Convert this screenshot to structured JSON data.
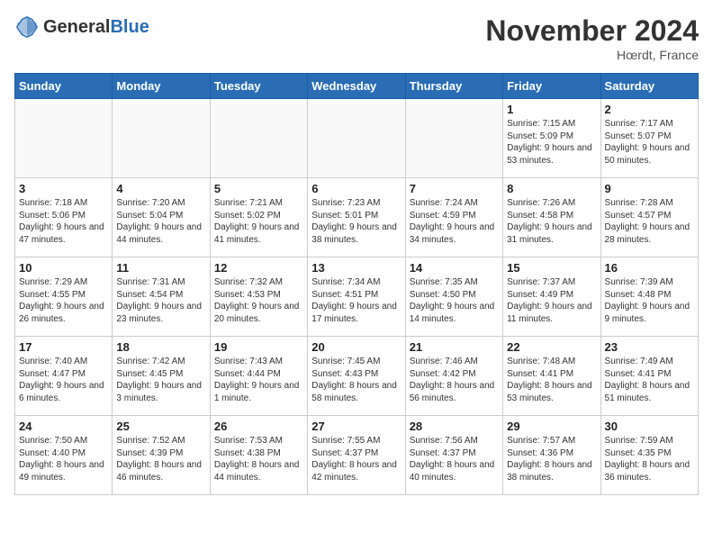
{
  "header": {
    "logo_general": "General",
    "logo_blue": "Blue",
    "month_title": "November 2024",
    "location": "Hœrdt, France"
  },
  "days_of_week": [
    "Sunday",
    "Monday",
    "Tuesday",
    "Wednesday",
    "Thursday",
    "Friday",
    "Saturday"
  ],
  "weeks": [
    [
      {
        "day": "",
        "info": ""
      },
      {
        "day": "",
        "info": ""
      },
      {
        "day": "",
        "info": ""
      },
      {
        "day": "",
        "info": ""
      },
      {
        "day": "",
        "info": ""
      },
      {
        "day": "1",
        "info": "Sunrise: 7:15 AM\nSunset: 5:09 PM\nDaylight: 9 hours and 53 minutes."
      },
      {
        "day": "2",
        "info": "Sunrise: 7:17 AM\nSunset: 5:07 PM\nDaylight: 9 hours and 50 minutes."
      }
    ],
    [
      {
        "day": "3",
        "info": "Sunrise: 7:18 AM\nSunset: 5:06 PM\nDaylight: 9 hours and 47 minutes."
      },
      {
        "day": "4",
        "info": "Sunrise: 7:20 AM\nSunset: 5:04 PM\nDaylight: 9 hours and 44 minutes."
      },
      {
        "day": "5",
        "info": "Sunrise: 7:21 AM\nSunset: 5:02 PM\nDaylight: 9 hours and 41 minutes."
      },
      {
        "day": "6",
        "info": "Sunrise: 7:23 AM\nSunset: 5:01 PM\nDaylight: 9 hours and 38 minutes."
      },
      {
        "day": "7",
        "info": "Sunrise: 7:24 AM\nSunset: 4:59 PM\nDaylight: 9 hours and 34 minutes."
      },
      {
        "day": "8",
        "info": "Sunrise: 7:26 AM\nSunset: 4:58 PM\nDaylight: 9 hours and 31 minutes."
      },
      {
        "day": "9",
        "info": "Sunrise: 7:28 AM\nSunset: 4:57 PM\nDaylight: 9 hours and 28 minutes."
      }
    ],
    [
      {
        "day": "10",
        "info": "Sunrise: 7:29 AM\nSunset: 4:55 PM\nDaylight: 9 hours and 26 minutes."
      },
      {
        "day": "11",
        "info": "Sunrise: 7:31 AM\nSunset: 4:54 PM\nDaylight: 9 hours and 23 minutes."
      },
      {
        "day": "12",
        "info": "Sunrise: 7:32 AM\nSunset: 4:53 PM\nDaylight: 9 hours and 20 minutes."
      },
      {
        "day": "13",
        "info": "Sunrise: 7:34 AM\nSunset: 4:51 PM\nDaylight: 9 hours and 17 minutes."
      },
      {
        "day": "14",
        "info": "Sunrise: 7:35 AM\nSunset: 4:50 PM\nDaylight: 9 hours and 14 minutes."
      },
      {
        "day": "15",
        "info": "Sunrise: 7:37 AM\nSunset: 4:49 PM\nDaylight: 9 hours and 11 minutes."
      },
      {
        "day": "16",
        "info": "Sunrise: 7:39 AM\nSunset: 4:48 PM\nDaylight: 9 hours and 9 minutes."
      }
    ],
    [
      {
        "day": "17",
        "info": "Sunrise: 7:40 AM\nSunset: 4:47 PM\nDaylight: 9 hours and 6 minutes."
      },
      {
        "day": "18",
        "info": "Sunrise: 7:42 AM\nSunset: 4:45 PM\nDaylight: 9 hours and 3 minutes."
      },
      {
        "day": "19",
        "info": "Sunrise: 7:43 AM\nSunset: 4:44 PM\nDaylight: 9 hours and 1 minute."
      },
      {
        "day": "20",
        "info": "Sunrise: 7:45 AM\nSunset: 4:43 PM\nDaylight: 8 hours and 58 minutes."
      },
      {
        "day": "21",
        "info": "Sunrise: 7:46 AM\nSunset: 4:42 PM\nDaylight: 8 hours and 56 minutes."
      },
      {
        "day": "22",
        "info": "Sunrise: 7:48 AM\nSunset: 4:41 PM\nDaylight: 8 hours and 53 minutes."
      },
      {
        "day": "23",
        "info": "Sunrise: 7:49 AM\nSunset: 4:41 PM\nDaylight: 8 hours and 51 minutes."
      }
    ],
    [
      {
        "day": "24",
        "info": "Sunrise: 7:50 AM\nSunset: 4:40 PM\nDaylight: 8 hours and 49 minutes."
      },
      {
        "day": "25",
        "info": "Sunrise: 7:52 AM\nSunset: 4:39 PM\nDaylight: 8 hours and 46 minutes."
      },
      {
        "day": "26",
        "info": "Sunrise: 7:53 AM\nSunset: 4:38 PM\nDaylight: 8 hours and 44 minutes."
      },
      {
        "day": "27",
        "info": "Sunrise: 7:55 AM\nSunset: 4:37 PM\nDaylight: 8 hours and 42 minutes."
      },
      {
        "day": "28",
        "info": "Sunrise: 7:56 AM\nSunset: 4:37 PM\nDaylight: 8 hours and 40 minutes."
      },
      {
        "day": "29",
        "info": "Sunrise: 7:57 AM\nSunset: 4:36 PM\nDaylight: 8 hours and 38 minutes."
      },
      {
        "day": "30",
        "info": "Sunrise: 7:59 AM\nSunset: 4:35 PM\nDaylight: 8 hours and 36 minutes."
      }
    ]
  ]
}
